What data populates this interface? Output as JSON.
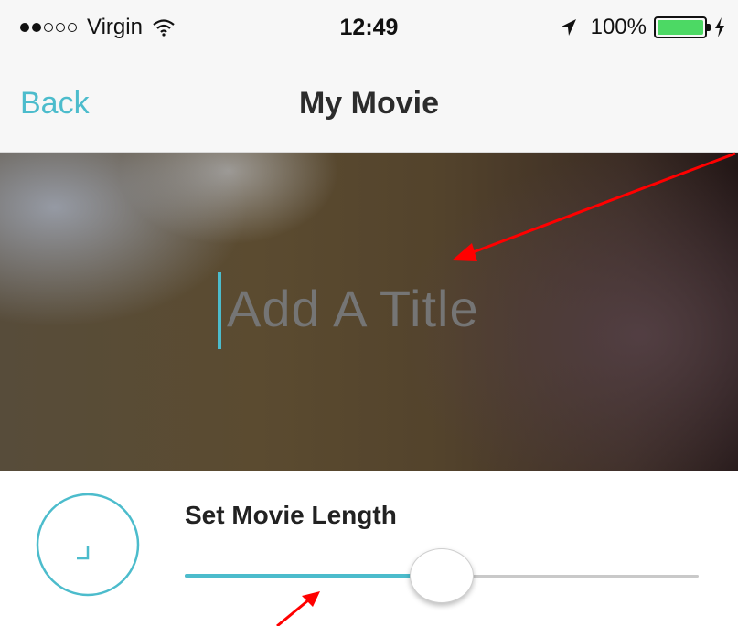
{
  "status_bar": {
    "carrier": "Virgin",
    "signal_bars": [
      true,
      true,
      false,
      false,
      false
    ],
    "time": "12:49",
    "battery_percent": "100%",
    "battery_level": 1.0,
    "icons": [
      "wifi-icon",
      "location-arrow-icon",
      "battery-icon",
      "charging-bolt-icon"
    ]
  },
  "nav": {
    "back_label": "Back",
    "title": "My Movie"
  },
  "hero": {
    "title_placeholder": "Add A Title",
    "title_value": ""
  },
  "movie_length": {
    "label": "Set Movie Length",
    "slider_fraction": 0.5,
    "icon": "clock-icon"
  },
  "colors": {
    "accent": "#4cbccc",
    "annotation": "#ff0000",
    "battery_green": "#4cd964"
  }
}
